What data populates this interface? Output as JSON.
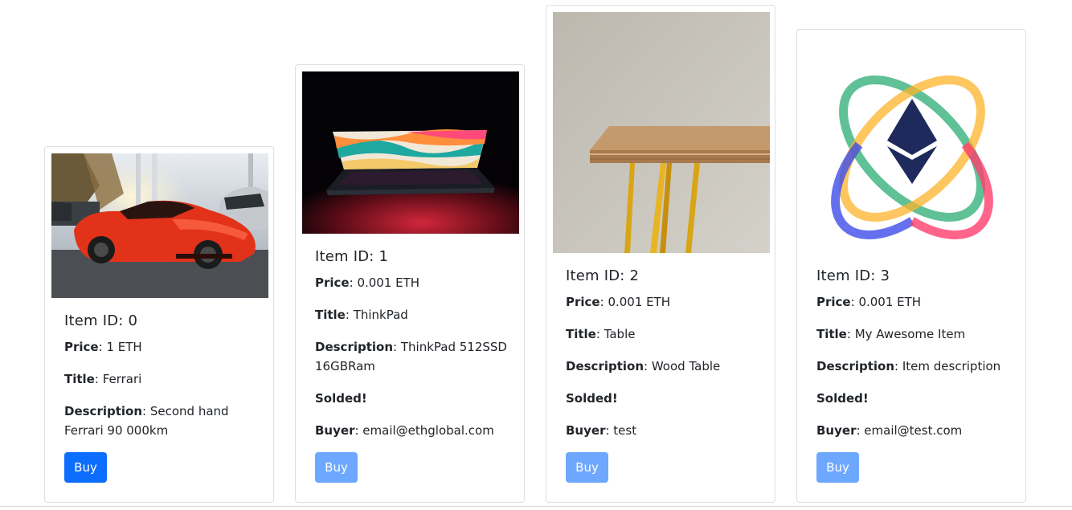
{
  "items": [
    {
      "id_label": "Item ID: 0",
      "price_label": "Price",
      "price_value": "1 ETH",
      "title_label": "Title",
      "title_value": "Ferrari",
      "description_label": "Description",
      "description_value": "Second hand Ferrari 90 000km",
      "buy_label": "Buy",
      "image": "red-sports-car-photo"
    },
    {
      "id_label": "Item ID: 1",
      "price_label": "Price",
      "price_value": "0.001 ETH",
      "title_label": "Title",
      "title_value": "ThinkPad",
      "description_label": "Description",
      "description_value": "ThinkPad 512SSD 16GBRam",
      "status": "Solded!",
      "buyer_label": "Buyer",
      "buyer_value": "email@ethglobal.com",
      "buy_label": "Buy",
      "image": "laptop-photo"
    },
    {
      "id_label": "Item ID: 2",
      "price_label": "Price",
      "price_value": "0.001 ETH",
      "title_label": "Title",
      "title_value": "Table",
      "description_label": "Description",
      "description_value": "Wood Table",
      "status": "Solded!",
      "buyer_label": "Buyer",
      "buyer_value": "test",
      "buy_label": "Buy",
      "image": "wood-table-photo"
    },
    {
      "id_label": "Item ID: 3",
      "price_label": "Price",
      "price_value": "0.001 ETH",
      "title_label": "Title",
      "title_value": "My Awesome Item",
      "description_label": "Description",
      "description_value": "Item description",
      "status": "Solded!",
      "buyer_label": "Buyer",
      "buyer_value": "email@test.com",
      "buy_label": "Buy",
      "image": "ethereum-logo"
    }
  ],
  "colors": {
    "primary": "#0d6efd",
    "primary_disabled": "#6ea8fe"
  }
}
